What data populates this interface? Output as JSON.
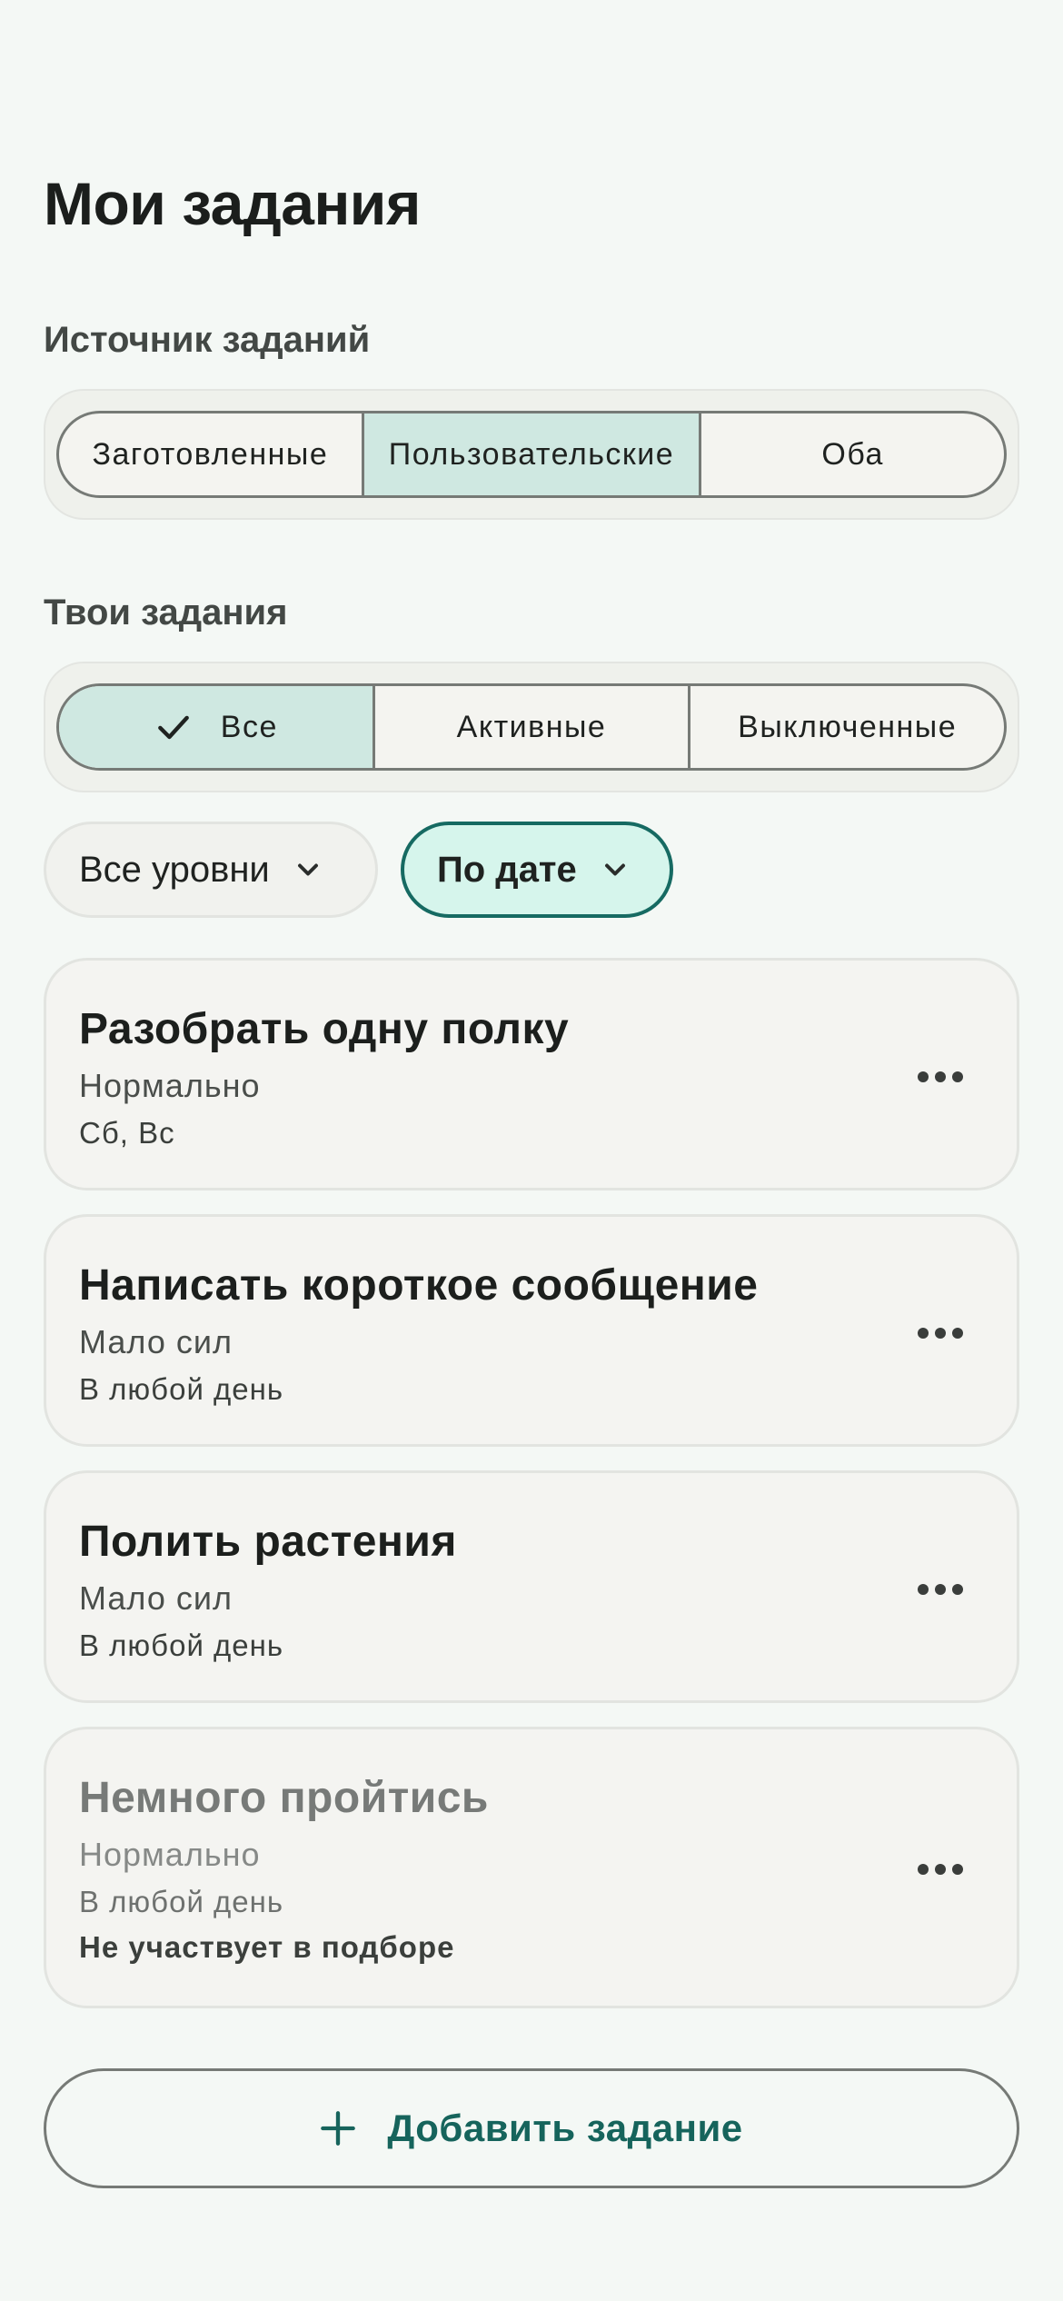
{
  "page_title": "Мои задания",
  "source": {
    "label": "Источник заданий",
    "options": [
      "Заготовленные",
      "Пользовательские",
      "Оба"
    ],
    "selected": "Пользовательские"
  },
  "yours": {
    "label": "Твои задания",
    "options": [
      "Все",
      "Активные",
      "Выключенные"
    ],
    "selected": "Все"
  },
  "filters": {
    "level_label": "Все уровни",
    "sort_label": "По дате"
  },
  "tasks": [
    {
      "title": "Разобрать одну полку",
      "level": "Нормально",
      "days": "Сб, Вс",
      "note": ""
    },
    {
      "title": "Написать короткое сообщение",
      "level": "Мало сил",
      "days": "В любой день",
      "note": ""
    },
    {
      "title": "Полить растения",
      "level": "Мало сил",
      "days": "В любой день",
      "note": ""
    },
    {
      "title": "Немного пройтись",
      "level": "Нормально",
      "days": "В любой день",
      "note": "Не участвует в подборе"
    }
  ],
  "add_button_label": "Добавить задание",
  "icons": {
    "check": "check-icon",
    "chevron": "chevron-down-icon",
    "more": "more-horizontal-icon",
    "plus": "plus-icon"
  },
  "colors": {
    "background": "#f4f8f5",
    "selected_segment": "#cfe8e1",
    "accent": "#166a62",
    "active_chip_fill": "#d6f5ec"
  }
}
